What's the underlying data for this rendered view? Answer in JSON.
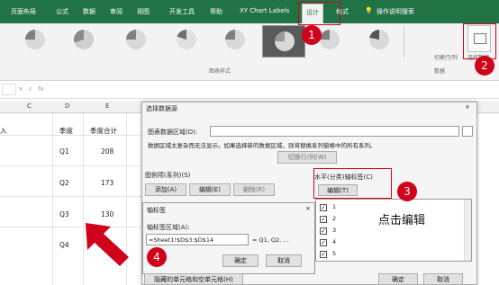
{
  "ribbon_tabs": [
    "页面布局",
    "公式",
    "数据",
    "审阅",
    "视图",
    "开发工具",
    "帮助",
    "XY Chart Labels",
    "设计",
    "格式",
    "操作说明搜索"
  ],
  "active_tab": "设计",
  "ribbon_group_label": "图表样式",
  "ribbon_right_labels": [
    "切换行/列",
    "选择数据",
    "数据"
  ],
  "formula_bar": {
    "name_box": "",
    "fx": "fx"
  },
  "columns": [
    "C",
    "D",
    "E"
  ],
  "sheet": {
    "header": [
      "季度",
      "季度合计"
    ],
    "rows": [
      [
        "Q1",
        "208"
      ],
      [
        "Q2",
        "173"
      ],
      [
        "Q3",
        "130"
      ],
      [
        "Q4",
        ""
      ]
    ]
  },
  "row_stub": "入",
  "dialog": {
    "title": "选择数据源",
    "range_label": "图表数据区域(D):",
    "range_note": "数据区域太复杂而无法显示。如果选择新的数据区域，则将替换系列窗格中的所有系列。",
    "switch_button": "切换行/列(W)",
    "legend_label": "图例项(系列)(S)",
    "legend_buttons": [
      "添加(A)",
      "编辑(E)",
      "删除(R)"
    ],
    "axis_label": "水平(分类)轴标签(C)",
    "edit_button": "编辑(T)",
    "axis_items": [
      "1",
      "2",
      "3",
      "4",
      "5"
    ],
    "hidden_button": "隐藏的单元格和空单元格(H)",
    "ok": "确定",
    "cancel": "取消"
  },
  "axis_dialog": {
    "title": "轴标签",
    "range_label": "轴标签区域(A):",
    "range_value": "=Sheet1!$D$3:$D$14",
    "preview": "= Q1, Q2, ...",
    "ok": "确定",
    "cancel": "取消"
  },
  "annotation_text": "点击编辑",
  "badges": [
    "1",
    "2",
    "3",
    "4"
  ],
  "colors": {
    "excel_green": "#217346",
    "red": "#d0021b"
  }
}
